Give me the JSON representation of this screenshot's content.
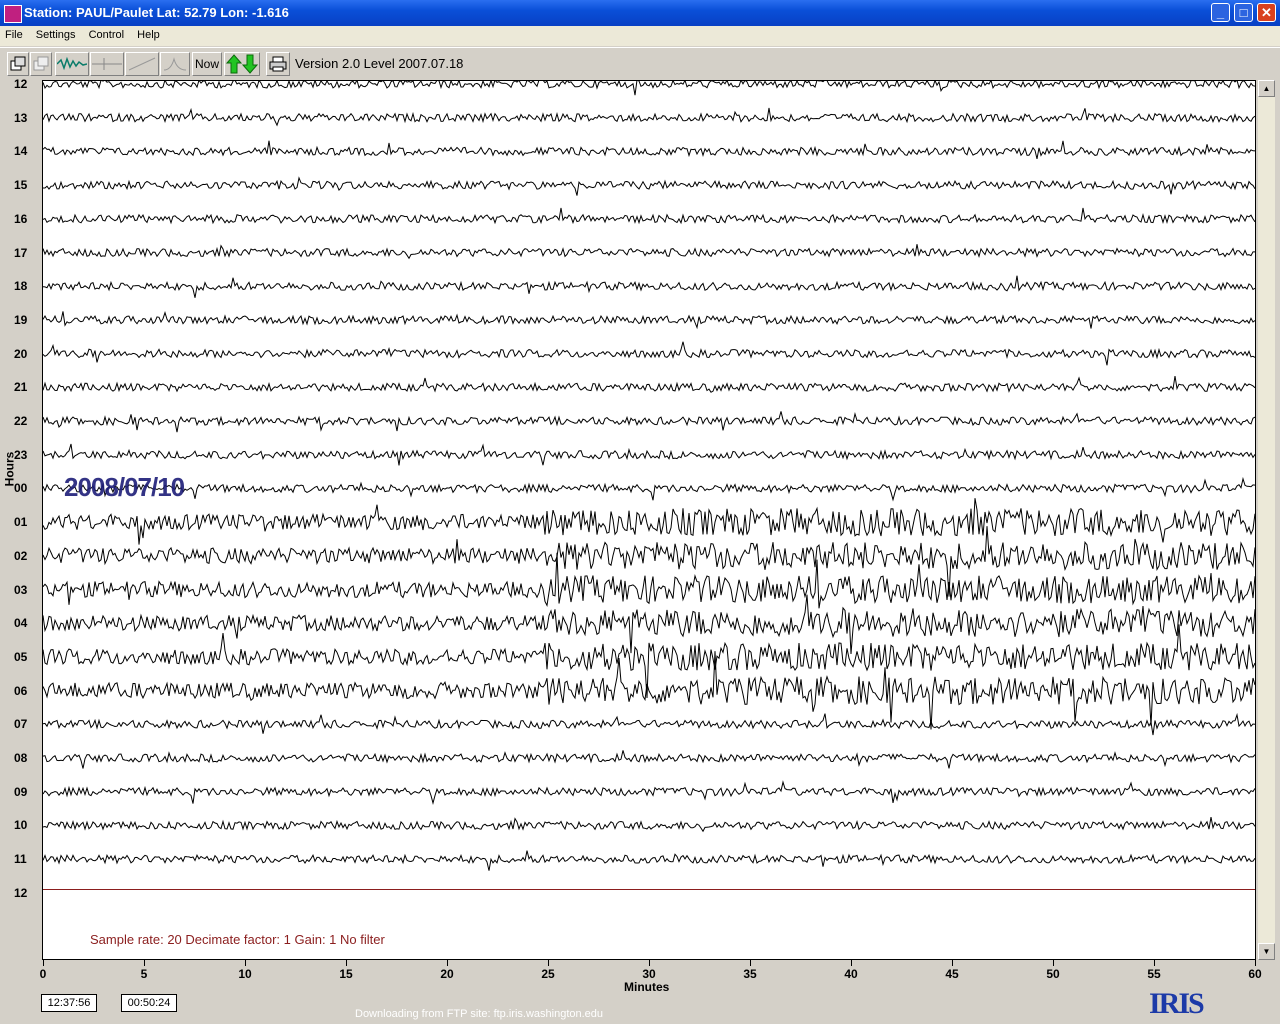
{
  "window": {
    "title": "Station: PAUL/Paulet Lat: 52.79 Lon: -1.616",
    "minimize": "_",
    "maximize": "□",
    "close": "✕"
  },
  "menu": [
    "File",
    "Settings",
    "Control",
    "Help"
  ],
  "toolbar": {
    "buttons": [
      "open-icon",
      "save-icon",
      "waveform-icon",
      "pick-icon",
      "slope-icon",
      "spectrum-icon"
    ],
    "now_label": "Now",
    "version": "Version 2.0 Level 2007.07.18"
  },
  "plot": {
    "hour_rows": [
      "12",
      "13",
      "14",
      "15",
      "16",
      "17",
      "18",
      "19",
      "20",
      "21",
      "22",
      "23",
      "00",
      "01",
      "02",
      "03",
      "04",
      "05",
      "06",
      "07",
      "08",
      "09",
      "10",
      "11",
      "12"
    ],
    "y_axis_title": "Hours",
    "date_stamp": "2008/07/10",
    "x_axis_title": "Minutes",
    "x_ticks": [
      "0",
      "5",
      "10",
      "15",
      "20",
      "25",
      "30",
      "35",
      "40",
      "45",
      "50",
      "55",
      "60"
    ],
    "status": "Sample rate: 20  Decimate factor: 1  Gain: 1  No filter",
    "trace_color": "#000000",
    "final_line_color": "#8b1e1e"
  },
  "footer": {
    "time_left": "12:37:56",
    "time_right": "00:50:24",
    "ftp_status": "Downloading from FTP site: ftp.iris.washington.edu",
    "logo_text": "IRIS"
  }
}
